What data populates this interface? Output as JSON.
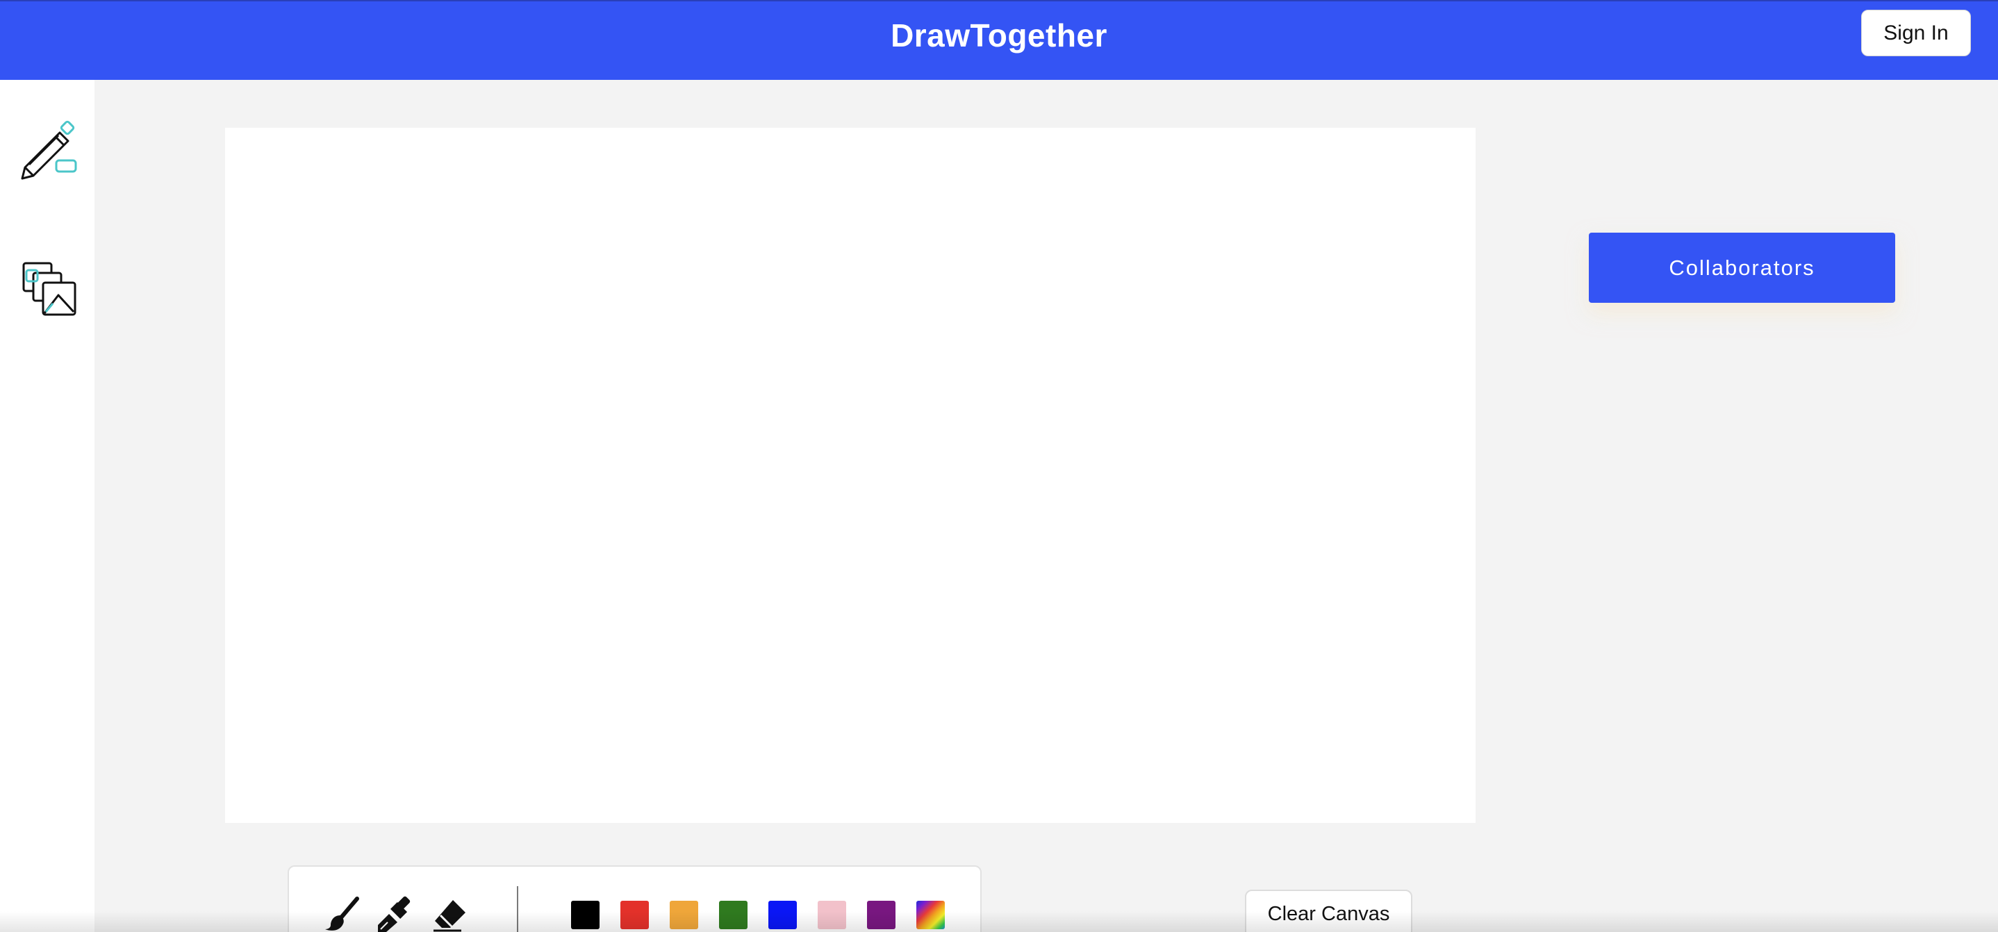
{
  "header": {
    "title": "DrawTogether",
    "sign_in_label": "Sign In",
    "background_color": "#3454f4"
  },
  "sidebar": {
    "tools": [
      {
        "name": "pencil-shapes-icon",
        "label": "Draw"
      },
      {
        "name": "image-gallery-icon",
        "label": "Images"
      }
    ]
  },
  "canvas": {
    "background_color": "#ffffff"
  },
  "collaborators": {
    "label": "Collaborators"
  },
  "toolbar": {
    "brushes": [
      {
        "name": "paintbrush-icon"
      },
      {
        "name": "broad-brush-icon"
      },
      {
        "name": "eraser-icon"
      }
    ],
    "colors": [
      {
        "name": "black",
        "hex": "#000000"
      },
      {
        "name": "red",
        "hex": "#e3312a"
      },
      {
        "name": "orange",
        "hex": "#efa63a"
      },
      {
        "name": "green",
        "hex": "#2f7a1f"
      },
      {
        "name": "blue",
        "hex": "#0a16f5"
      },
      {
        "name": "pink",
        "hex": "#f2c1ca"
      },
      {
        "name": "purple",
        "hex": "#781780"
      },
      {
        "name": "rainbow",
        "hex": "gradient"
      }
    ]
  },
  "clear_button": {
    "label": "Clear Canvas"
  },
  "accent_colors": {
    "primary": "#3454f4",
    "icon_accent": "#4bc6c9"
  }
}
